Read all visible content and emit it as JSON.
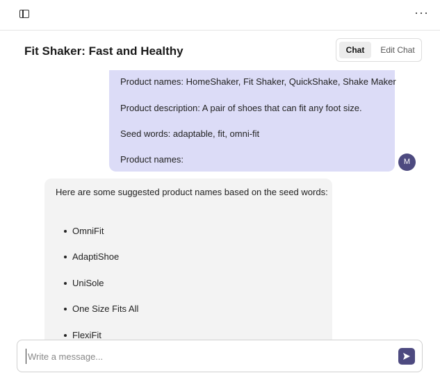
{
  "topbar": {
    "sidebar_toggle_icon": "sidebar-panel-icon",
    "more_icon": "more-horizontal-icon",
    "more_label": "···"
  },
  "header": {
    "title": "Fit Shaker: Fast and Healthy",
    "tabs": [
      {
        "label": "Chat",
        "active": true
      },
      {
        "label": "Edit Chat",
        "active": false
      }
    ]
  },
  "user_message": {
    "lines": [
      "Product names: HomeShaker, Fit Shaker, QuickShake, Shake Maker",
      "Product description: A pair of shoes that can fit any foot size.",
      "Seed words: adaptable, fit, omni-fit",
      "Product names:"
    ],
    "avatar_letter": "M"
  },
  "assistant_message": {
    "intro": "Here are some suggested product names based on the seed words:",
    "items": [
      "OmniFit",
      "AdaptiShoe",
      "UniSole",
      "One Size Fits All",
      "FlexiFit"
    ]
  },
  "composer": {
    "placeholder": "Write a message...",
    "value": "",
    "send_icon": "send-icon"
  },
  "colors": {
    "user_bubble": "#dcdcf7",
    "assistant_bubble": "#f3f3f3",
    "accent": "#4d4a80"
  }
}
